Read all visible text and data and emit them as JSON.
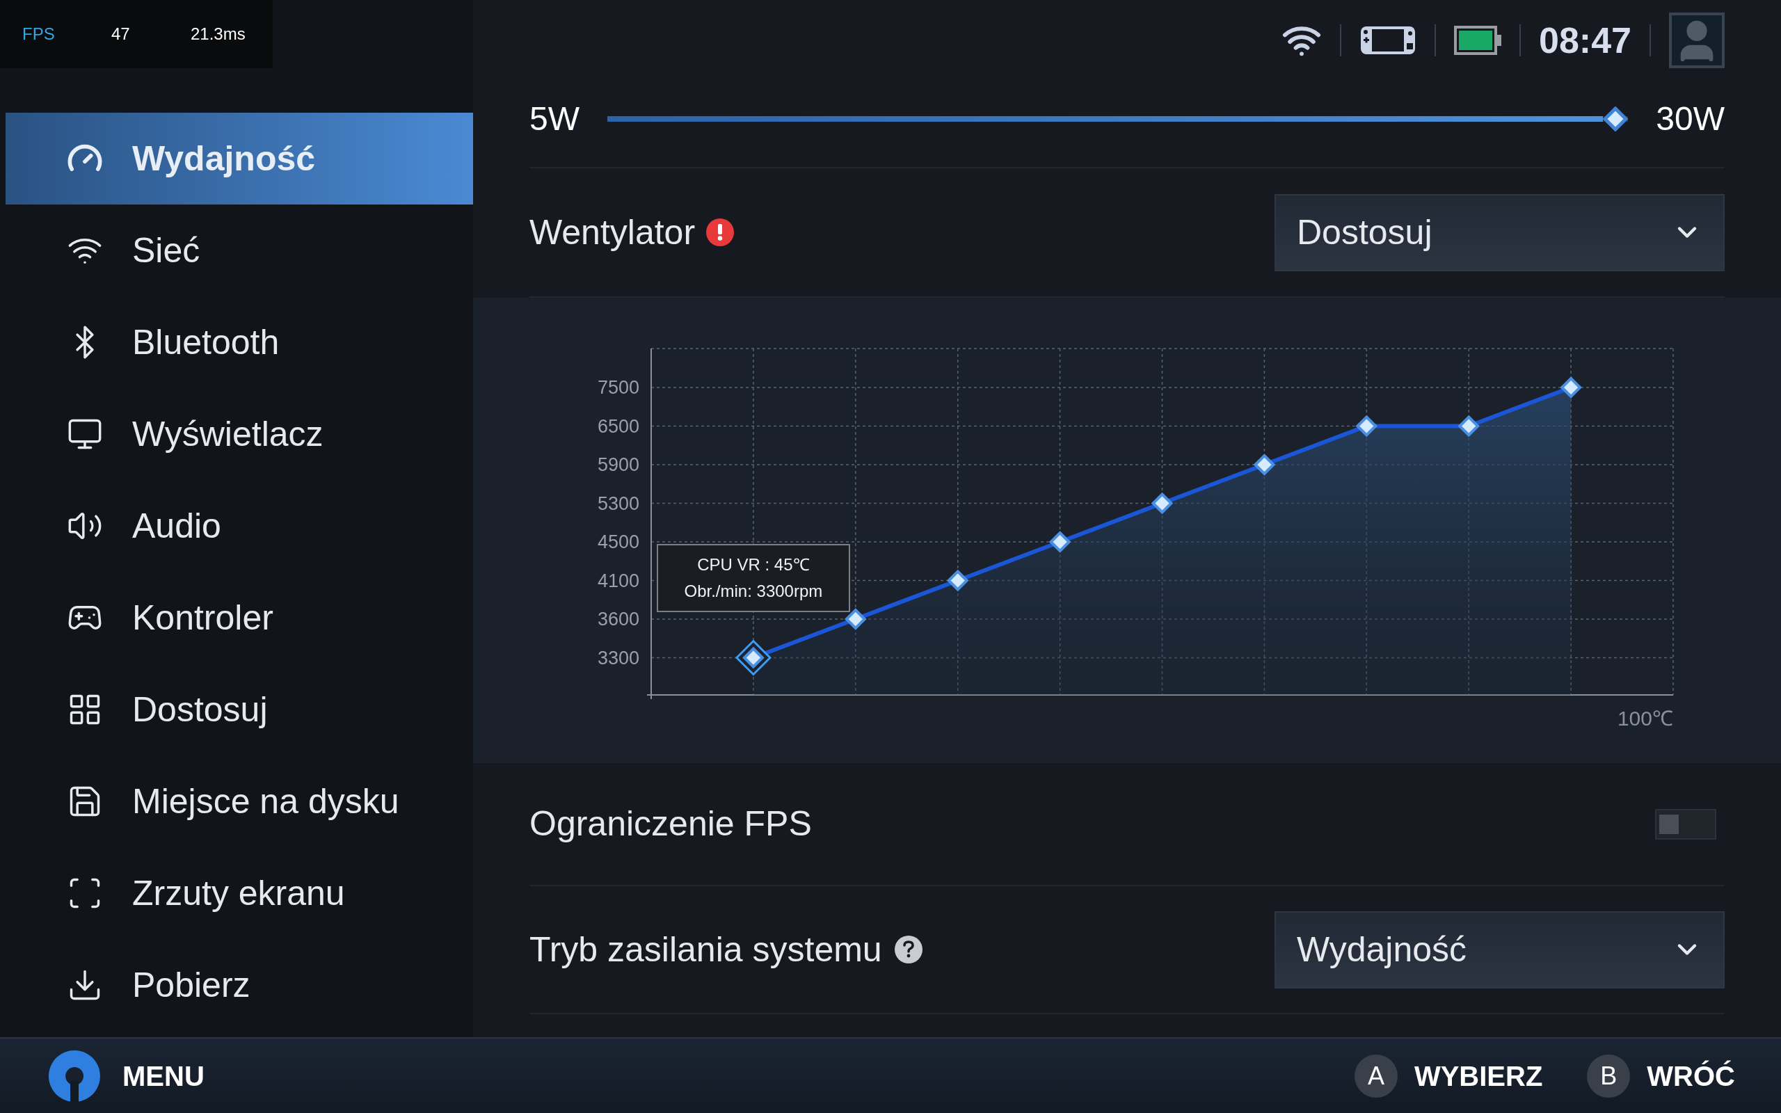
{
  "fps_overlay": {
    "label": "FPS",
    "fps": "47",
    "frame_time": "21.3ms"
  },
  "sidebar": {
    "items": [
      {
        "label": "Wydajność",
        "selected": true
      },
      {
        "label": "Sieć",
        "selected": false
      },
      {
        "label": "Bluetooth",
        "selected": false
      },
      {
        "label": "Wyświetlacz",
        "selected": false
      },
      {
        "label": "Audio",
        "selected": false
      },
      {
        "label": "Kontroler",
        "selected": false
      },
      {
        "label": "Dostosuj",
        "selected": false
      },
      {
        "label": "Miejsce na dysku",
        "selected": false
      },
      {
        "label": "Zrzuty ekranu",
        "selected": false
      },
      {
        "label": "Pobierz",
        "selected": false
      }
    ]
  },
  "status": {
    "time": "08:47"
  },
  "power_slider": {
    "min_label": "5W",
    "max_label": "30W",
    "level": 1
  },
  "fan": {
    "label": "Wentylator",
    "warning": true,
    "mode": "Dostosuj",
    "curve": {
      "y_labels": [
        "7500",
        "6500",
        "5900",
        "5300",
        "4500",
        "4100",
        "3600",
        "3300"
      ],
      "x_label": "100℃",
      "tooltip": [
        "CPU VR : 45℃",
        "Obr./min: 3300rpm"
      ]
    }
  },
  "fps_limit": {
    "label": "Ograniczenie FPS",
    "on": false
  },
  "power_mode": {
    "label": "Tryb zasilania systemu",
    "value": "Wydajność"
  },
  "bottom_bar": {
    "menu": "MENU",
    "actions": [
      {
        "key": "A",
        "label": "WYBIERZ"
      },
      {
        "key": "B",
        "label": "WRÓĆ"
      }
    ]
  }
}
